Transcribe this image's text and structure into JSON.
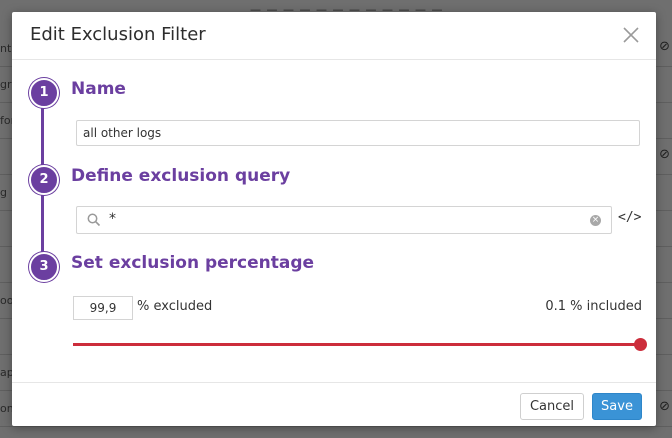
{
  "background": {
    "top_text": "— — — — — — — — — — — —",
    "fragments": [
      "nta",
      "gra",
      "for",
      "",
      "g",
      "",
      "",
      "oo",
      "",
      "ap",
      "on"
    ]
  },
  "modal": {
    "title": "Edit Exclusion Filter",
    "close_icon": "close-icon"
  },
  "steps": [
    {
      "number": "1",
      "title": "Name"
    },
    {
      "number": "2",
      "title": "Define exclusion query"
    },
    {
      "number": "3",
      "title": "Set exclusion percentage"
    }
  ],
  "name_input": {
    "value": "all other logs"
  },
  "query_input": {
    "value": "*",
    "code_toggle": "</>"
  },
  "percentage": {
    "excluded_value": "99,9",
    "excluded_label": "% excluded",
    "included_label": "0.1 % included",
    "slider_fraction": 0.999
  },
  "footer": {
    "cancel_label": "Cancel",
    "save_label": "Save"
  },
  "colors": {
    "accent": "#6b3fa0",
    "slider": "#cc2d3b",
    "primary_button": "#3a93d6"
  }
}
